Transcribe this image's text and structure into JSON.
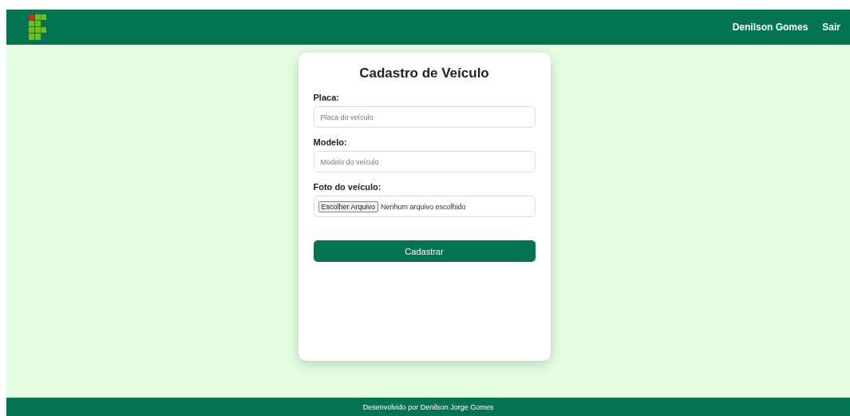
{
  "header": {
    "user_name": "Denilson Gomes",
    "logout": "Sair"
  },
  "form": {
    "title": "Cadastro de Veículo",
    "fields": [
      {
        "kind": "text",
        "label": "Placa:",
        "placeholder": "Placa do veículo"
      },
      {
        "kind": "text",
        "label": "Modelo:",
        "placeholder": "Modelo do veículo"
      },
      {
        "kind": "file",
        "label": "Foto do veículo:",
        "button": "Escolher Arquivo",
        "status": "Nenhum arquivo escolhido"
      }
    ],
    "submit": "Cadastrar"
  },
  "footer": "Desenvolvido por Denilson Jorge Gomes"
}
